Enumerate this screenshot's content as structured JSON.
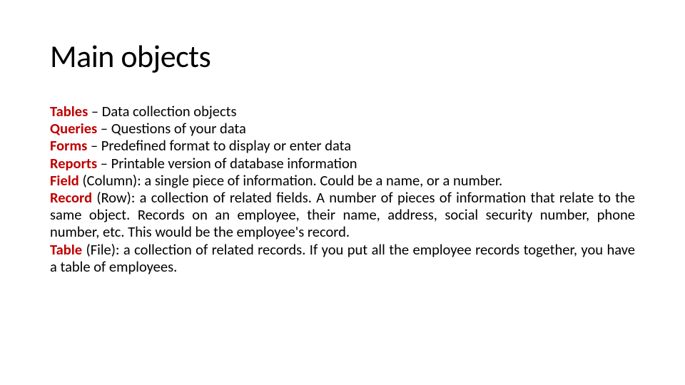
{
  "title": "Main objects",
  "items": [
    {
      "term": "Tables",
      "desc": " – Data collection objects",
      "justify": false
    },
    {
      "term": "Queries",
      "desc": " – Questions of your data",
      "justify": false
    },
    {
      "term": "Forms",
      "desc": " – Predefined format to display or enter data",
      "justify": false
    },
    {
      "term": "Reports",
      "desc": " – Printable version of database information",
      "justify": false
    },
    {
      "term": "Field",
      "desc": " (Column): a single piece of information.  Could be a name, or a number.",
      "justify": false
    },
    {
      "term": "Record",
      "desc": " (Row): a collection of related fields. A number of pieces of information that relate to the same object. Records on an employee, their name, address, social security number, phone number, etc. This would be the employee's record.",
      "justify": true
    },
    {
      "term": "Table",
      "desc": " (File): a collection of related records.  If you put all the employee records together, you have a table of employees.",
      "justify": true
    }
  ]
}
